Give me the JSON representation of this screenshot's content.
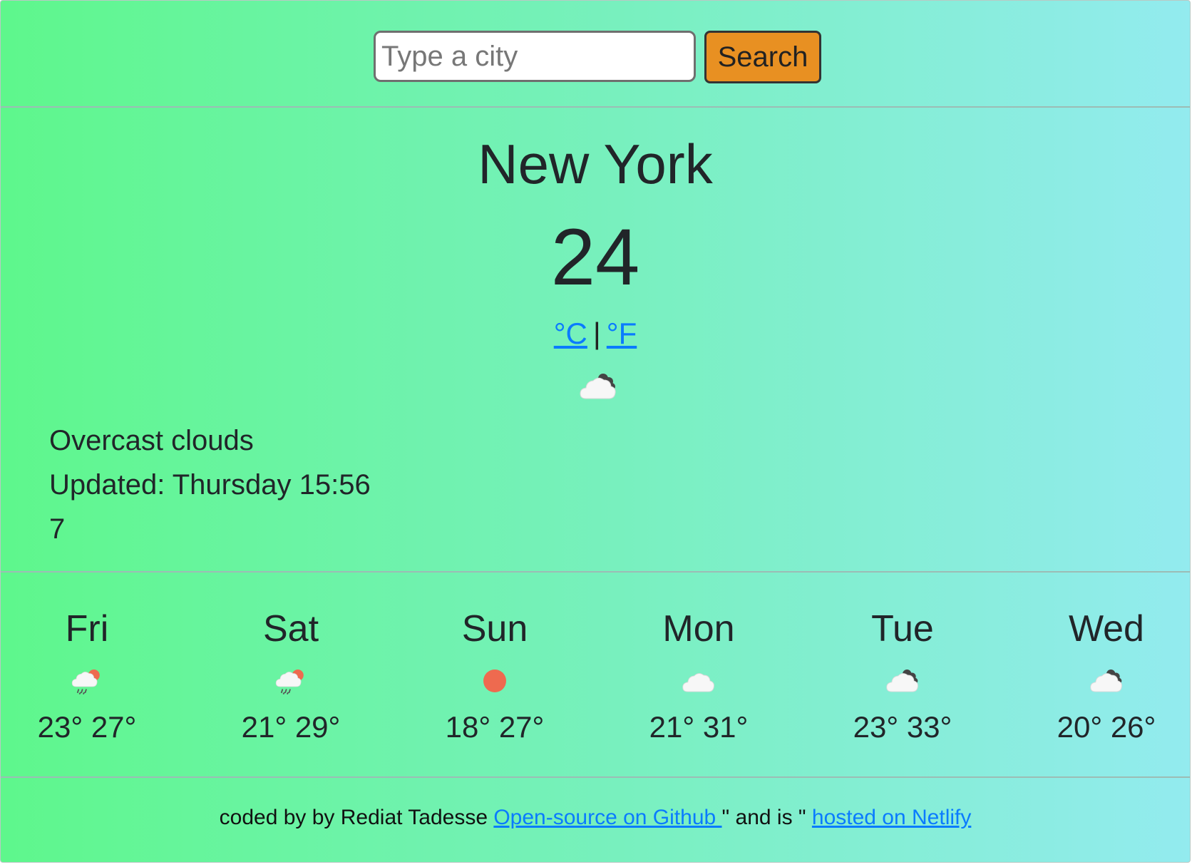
{
  "search": {
    "placeholder": "Type a city",
    "button_label": "Search"
  },
  "current": {
    "city": "New York",
    "temperature": "24",
    "unit_celsius": "°C",
    "unit_separator": "|",
    "unit_fahrenheit": "°F",
    "icon": "cloud-dark-icon",
    "description": "Overcast clouds",
    "updated": "Updated: Thursday 15:56",
    "extra_value": "7"
  },
  "forecast": [
    {
      "day": "Fri",
      "icon": "rain-sun-icon",
      "temps": "23° 27°"
    },
    {
      "day": "Sat",
      "icon": "rain-sun-icon",
      "temps": "21° 29°"
    },
    {
      "day": "Sun",
      "icon": "sun-icon",
      "temps": "18° 27°"
    },
    {
      "day": "Mon",
      "icon": "cloud-icon",
      "temps": "21° 31°"
    },
    {
      "day": "Tue",
      "icon": "cloud-dark-icon",
      "temps": "23° 33°"
    },
    {
      "day": "Wed",
      "icon": "cloud-dark-icon",
      "temps": "20° 26°"
    }
  ],
  "footer": {
    "prefix": "coded by by Rediat Tadesse ",
    "github_link": "Open-source on Github ",
    "middle": "\" and is \" ",
    "netlify_link": "hosted on Netlify"
  },
  "colors": {
    "gradient_start": "#5ef78c",
    "gradient_end": "#93ebef",
    "button": "#e89022",
    "link": "#0a7bff",
    "sun": "#ee6a4f"
  }
}
